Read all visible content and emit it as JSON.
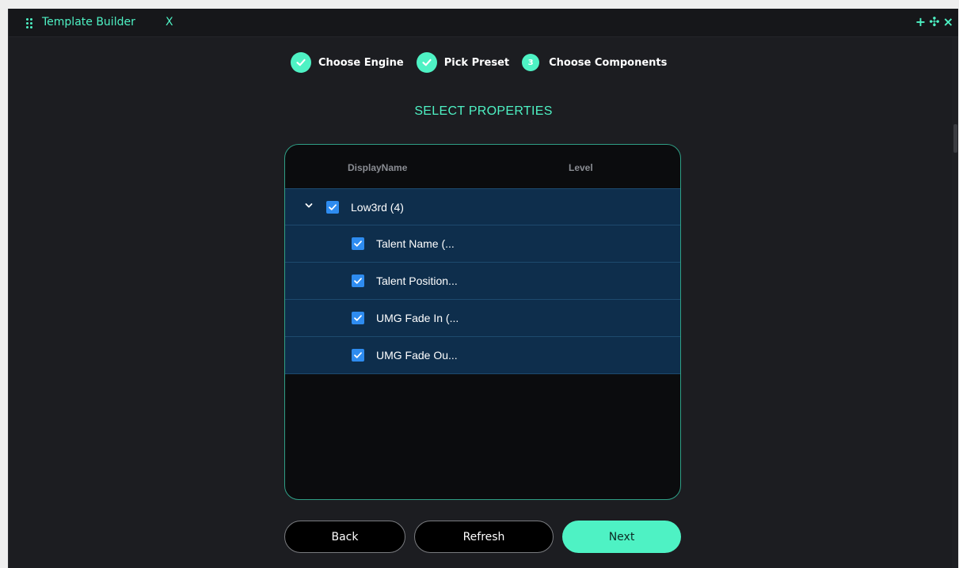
{
  "window": {
    "title": "Template Builder",
    "close_label": "X",
    "actions": [
      "+",
      "✣",
      "×"
    ]
  },
  "stepper": {
    "steps": [
      {
        "label": "Choose Engine",
        "state": "done"
      },
      {
        "label": "Pick Preset",
        "state": "done"
      },
      {
        "label": "Choose Components",
        "state": "current",
        "number": "3"
      }
    ]
  },
  "section_title": "SELECT PROPERTIES",
  "table": {
    "columns": [
      "DisplayName",
      "Level"
    ],
    "rows": [
      {
        "label": "Low3rd (4)",
        "checked": true,
        "expanded": true,
        "indent": 0
      },
      {
        "label": "Talent Name (...",
        "checked": true,
        "indent": 1
      },
      {
        "label": "Talent Position...",
        "checked": true,
        "indent": 1
      },
      {
        "label": "UMG Fade In (...",
        "checked": true,
        "indent": 1
      },
      {
        "label": "UMG Fade Ou...",
        "checked": true,
        "indent": 1
      }
    ]
  },
  "buttons": {
    "back": "Back",
    "refresh": "Refresh",
    "next": "Next"
  },
  "colors": {
    "accent": "#4ef2c4",
    "row_bg": "#0e2e4c",
    "checkbox": "#2e8cf0",
    "window_bg": "#1c1d21"
  }
}
